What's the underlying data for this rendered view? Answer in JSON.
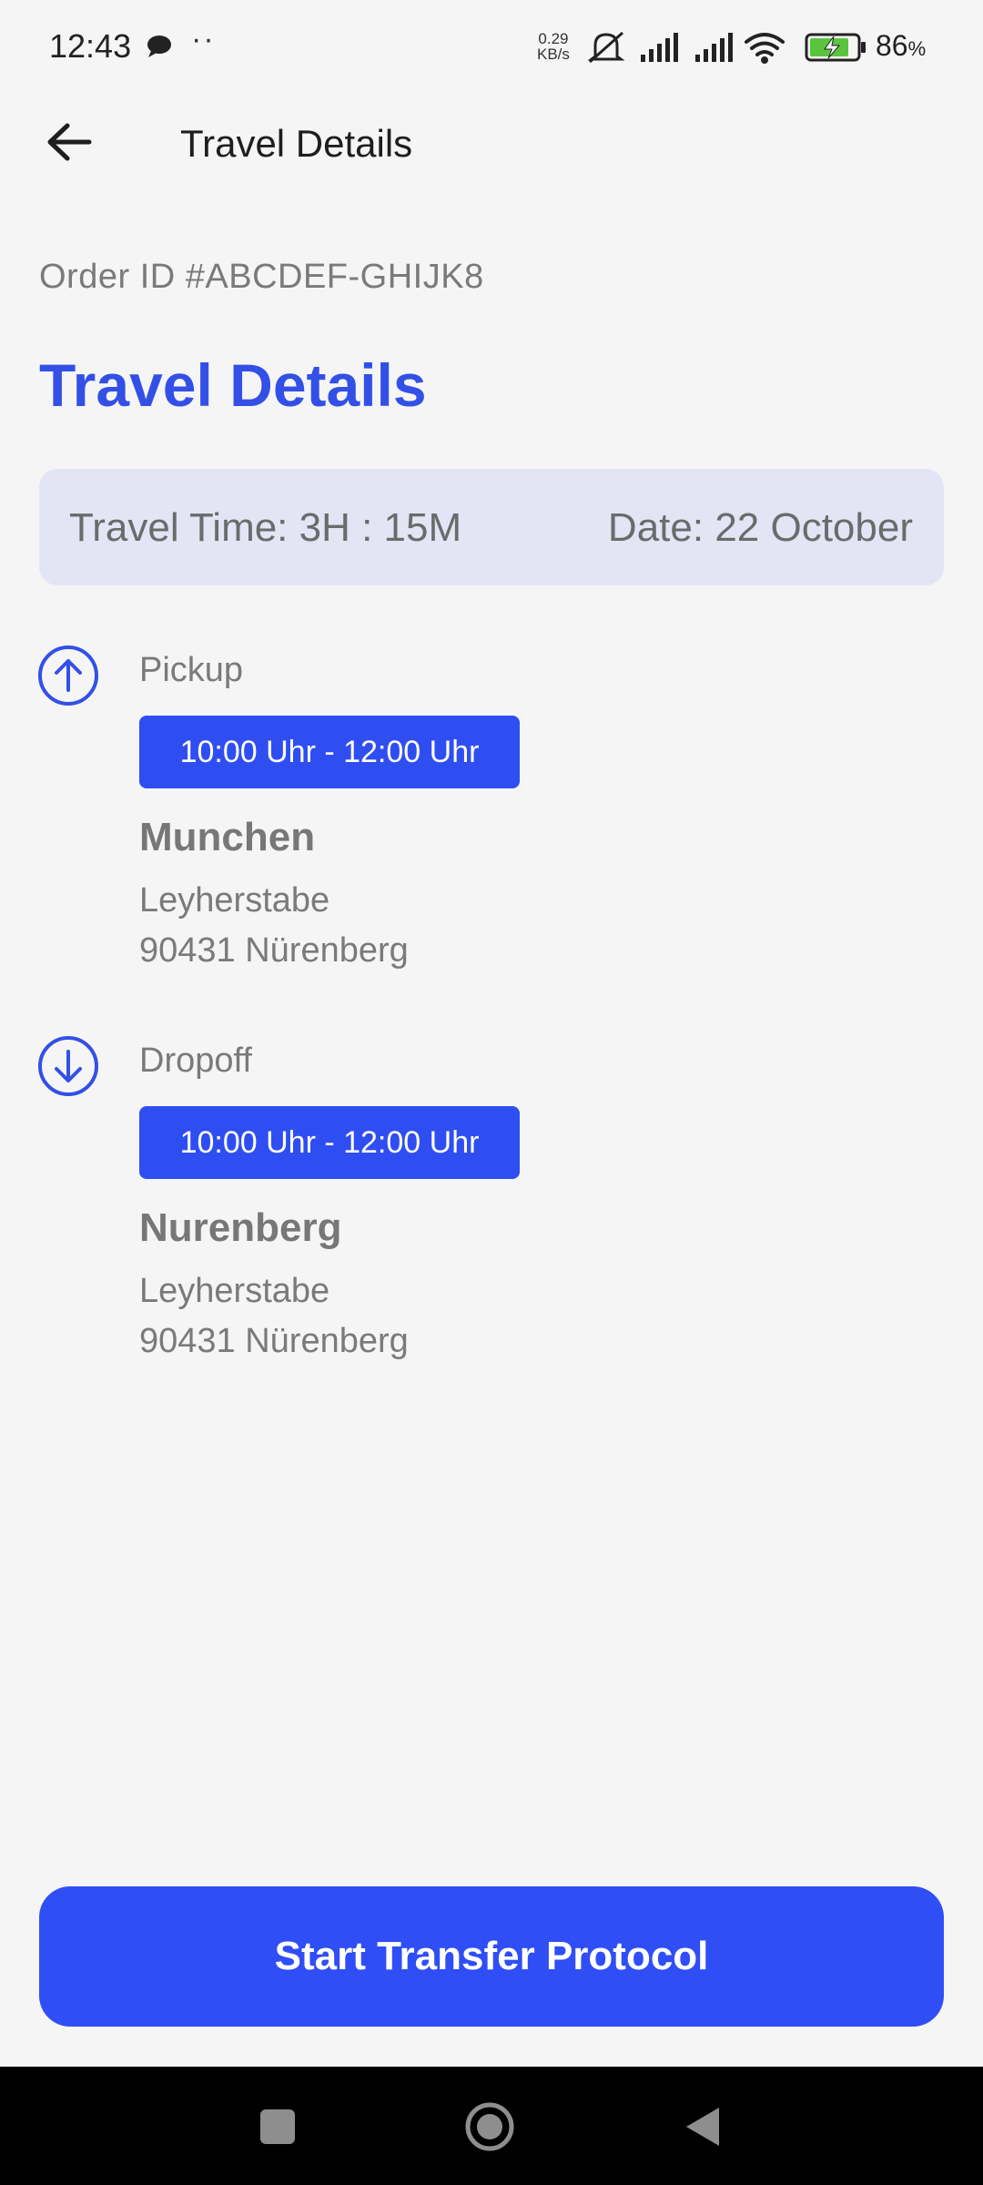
{
  "status_bar": {
    "time": "12:43",
    "net_speed_value": "0.29",
    "net_speed_unit": "KB/s",
    "battery_percent": "86",
    "battery_unit": "%",
    "icons": [
      "chat-bubble-icon",
      "more-dots-icon",
      "mute-icon",
      "signal-icon",
      "signal-icon",
      "wifi-icon",
      "battery-charging-icon"
    ],
    "dots": "··"
  },
  "app_bar": {
    "title": "Travel Details"
  },
  "order": {
    "id_text": "Order ID #ABCDEF-GHIJK8"
  },
  "page": {
    "title": "Travel Details"
  },
  "info": {
    "travel_time": "Travel Time: 3H : 15M",
    "date": "Date: 22 October"
  },
  "pickup": {
    "label": "Pickup",
    "time_window": "10:00 Uhr - 12:00 Uhr",
    "city": "Munchen",
    "street": "Leyherstabe",
    "postal_city": "90431 Nürenberg"
  },
  "dropoff": {
    "label": "Dropoff",
    "time_window": "10:00 Uhr - 12:00 Uhr",
    "city": "Nurenberg",
    "street": "Leyherstabe",
    "postal_city": "90431 Nürenberg"
  },
  "actions": {
    "primary_label": "Start Transfer Protocol"
  },
  "colors": {
    "accent": "#3350e6",
    "button": "#2f4ef6",
    "chip": "#2f4ef2",
    "info_card": "#e3e5f5",
    "background": "#f5f5f5"
  }
}
